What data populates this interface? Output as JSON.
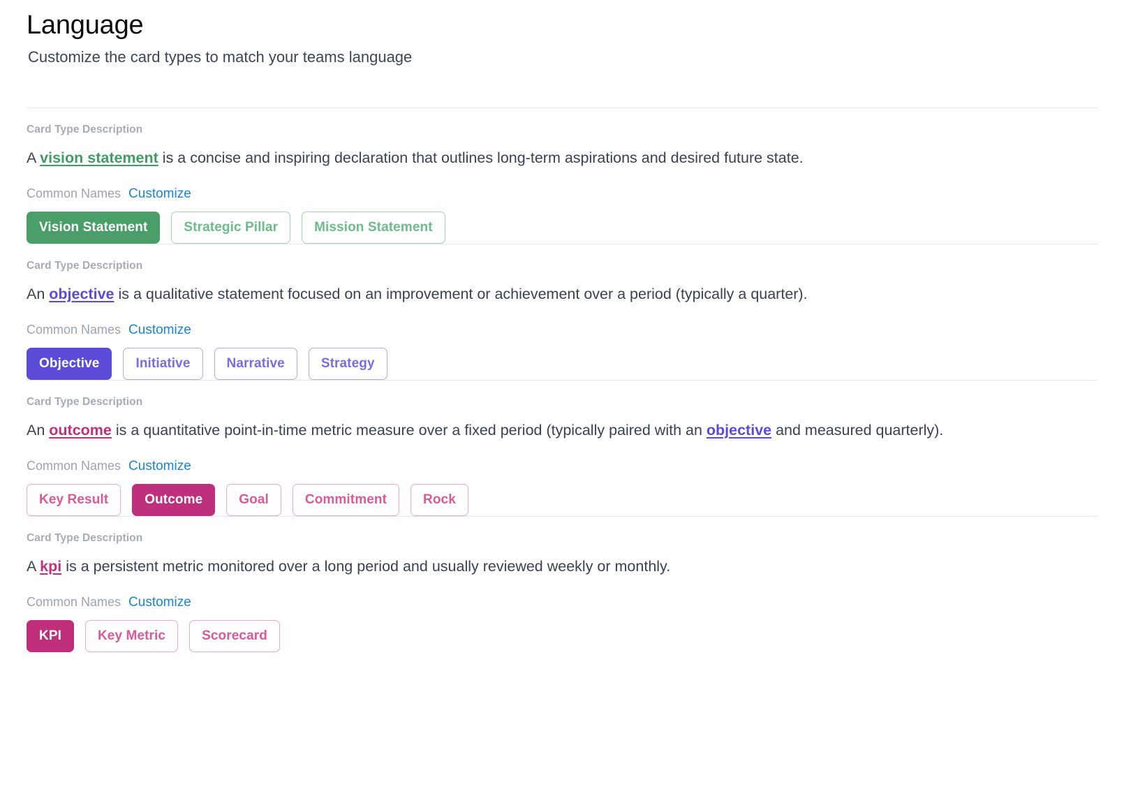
{
  "header": {
    "title": "Language",
    "subtitle": "Customize the card types to match your teams language"
  },
  "labels": {
    "card_type_description": "Card Type Description",
    "common_names": "Common Names",
    "customize": "Customize"
  },
  "colors": {
    "green": "#4a9e68",
    "purple": "#5b4bd6",
    "pink": "#bf2f7b",
    "link_blue": "#1a85d6",
    "muted_label": "#a6abb6",
    "body_text": "#3a4154",
    "divider": "#e6e8ec"
  },
  "sections": [
    {
      "key": "vision",
      "theme": "green",
      "description": {
        "lead": "A ",
        "token": "vision statement",
        "token_color": "green",
        "rest": " is a concise and inspiring declaration that outlines long-term aspirations and desired future state."
      },
      "pills": [
        {
          "label": "Vision Statement",
          "selected": true
        },
        {
          "label": "Strategic Pillar",
          "selected": false
        },
        {
          "label": "Mission Statement",
          "selected": false
        }
      ]
    },
    {
      "key": "objective",
      "theme": "purple",
      "description": {
        "lead": "An ",
        "token": "objective",
        "token_color": "purple",
        "rest": " is a qualitative statement focused on an improvement or achievement over a period (typically a quarter)."
      },
      "pills": [
        {
          "label": "Objective",
          "selected": true
        },
        {
          "label": "Initiative",
          "selected": false
        },
        {
          "label": "Narrative",
          "selected": false
        },
        {
          "label": "Strategy",
          "selected": false
        }
      ]
    },
    {
      "key": "outcome",
      "theme": "pink",
      "description": {
        "lead": "An ",
        "token": "outcome",
        "token_color": "pink",
        "rest": " is a quantitative point-in-time metric measure over a fixed period (typically paired with an ",
        "token2": "objective",
        "token2_color": "purple",
        "rest2": " and measured quarterly)."
      },
      "pills": [
        {
          "label": "Key Result",
          "selected": false
        },
        {
          "label": "Outcome",
          "selected": true
        },
        {
          "label": "Goal",
          "selected": false
        },
        {
          "label": "Commitment",
          "selected": false
        },
        {
          "label": "Rock",
          "selected": false
        }
      ]
    },
    {
      "key": "kpi",
      "theme": "pink",
      "description": {
        "lead": "A ",
        "token": "kpi",
        "token_color": "pink",
        "rest": " is a persistent metric monitored over a long period and usually reviewed weekly or monthly."
      },
      "pills": [
        {
          "label": "KPI",
          "selected": true
        },
        {
          "label": "Key Metric",
          "selected": false
        },
        {
          "label": "Scorecard",
          "selected": false
        }
      ]
    }
  ]
}
